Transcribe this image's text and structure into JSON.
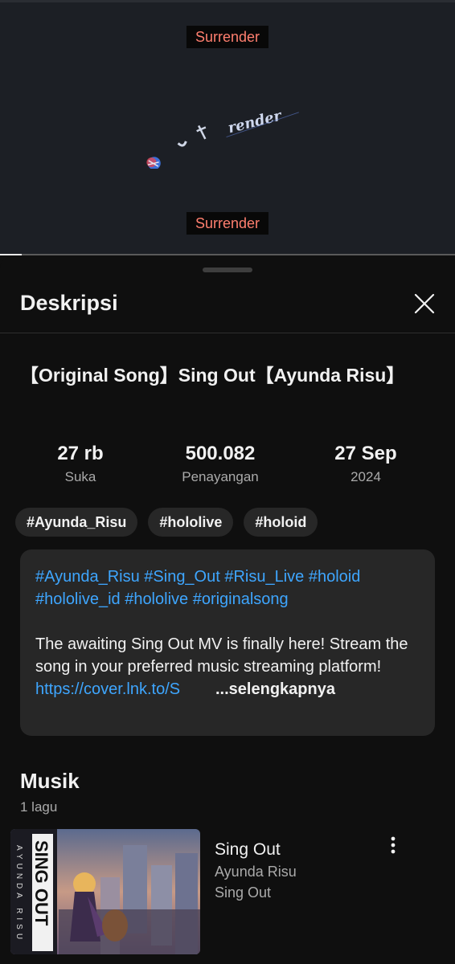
{
  "player": {
    "caption_top": "Surrender",
    "caption_bottom": "Surrender",
    "progress_fraction": 0.048
  },
  "sheet": {
    "title": "Deskripsi",
    "close_icon": "close-icon"
  },
  "video": {
    "title": "【Original Song】Sing Out【Ayunda Risu】",
    "stats": [
      {
        "value": "27 rb",
        "label": "Suka"
      },
      {
        "value": "500.082",
        "label": "Penayangan"
      },
      {
        "value": "27 Sep",
        "label": "2024"
      }
    ],
    "tags": [
      "#Ayunda_Risu",
      "#hololive",
      "#holoid"
    ],
    "description": {
      "hashtags_line1": "#Ayunda_Risu #Sing_Out #Risu_Live #holoid",
      "hashtags_line2": "#hololive_id #hololive #originalsong",
      "text": "The awaiting Sing Out MV is finally here! Stream the song in your preferred music streaming platform!",
      "link": "https://cover.lnk.to/S",
      "more_label": "...selengkapnya"
    }
  },
  "music": {
    "section_title": "Musik",
    "count": "1 lagu",
    "songs": [
      {
        "title": "Sing Out",
        "artist": "Ayunda Risu",
        "album": "Sing Out",
        "menu_icon": "more-vert-icon"
      }
    ]
  },
  "colors": {
    "background": "#0f0f0f",
    "surface": "#272727",
    "link": "#3ea6ff",
    "caption_text": "#ff7f6f",
    "secondary_text": "#aaaaaa"
  }
}
